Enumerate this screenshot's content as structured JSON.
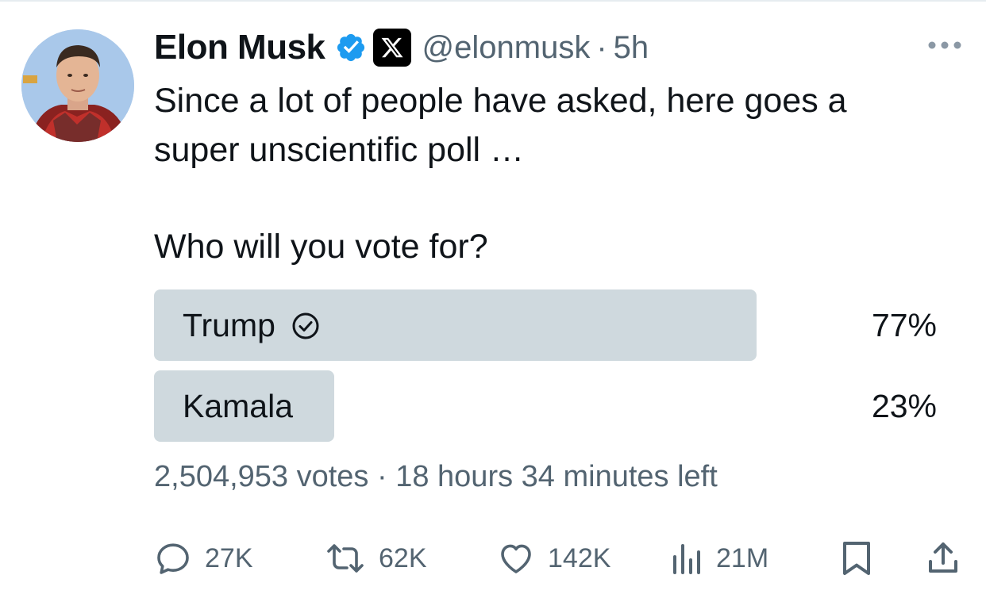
{
  "tweet": {
    "author_name": "Elon Musk",
    "handle": "@elonmusk",
    "separator": "·",
    "time": "5h",
    "text_line1": "Since a lot of people have asked, here goes a",
    "text_line2": "super unscientific poll …",
    "question": "Who will you vote for?"
  },
  "poll": {
    "options": [
      {
        "label": "Trump",
        "percent_text": "77%",
        "percent": 77,
        "winner": true
      },
      {
        "label": "Kamala",
        "percent_text": "23%",
        "percent": 23,
        "winner": false
      }
    ],
    "votes": "2,504,953 votes",
    "separator": "·",
    "time_left": "18 hours 34 minutes left"
  },
  "actions": {
    "replies": "27K",
    "reposts": "62K",
    "likes": "142K",
    "views": "21M"
  },
  "colors": {
    "verified": "#1d9bf0",
    "poll_fill": "#cfd9de",
    "secondary_text": "#536471"
  },
  "icons": [
    "verified-badge-icon",
    "x-logo-icon",
    "more-icon",
    "check-circle-icon",
    "reply-icon",
    "repost-icon",
    "like-icon",
    "views-icon",
    "bookmark-icon",
    "share-icon"
  ]
}
